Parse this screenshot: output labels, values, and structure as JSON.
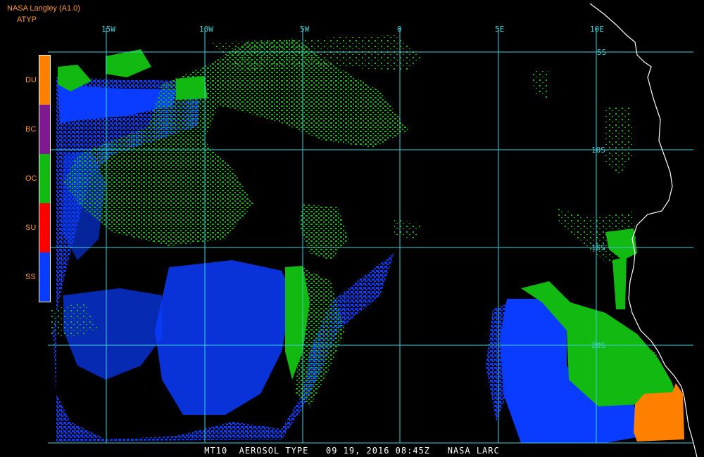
{
  "header": {
    "title": "NASA Langley (A1.0)",
    "product": "ATYP"
  },
  "legend": {
    "items": [
      {
        "code": "DU",
        "color": "#ff8000"
      },
      {
        "code": "BC",
        "color": "#7d1a8f"
      },
      {
        "code": "OC",
        "color": "#11b911"
      },
      {
        "code": "SU",
        "color": "#ff0000"
      },
      {
        "code": "SS",
        "color": "#0a3cff"
      }
    ]
  },
  "map": {
    "longitude_labels": [
      "15W",
      "10W",
      "5W",
      "0",
      "5E",
      "10E"
    ],
    "latitude_labels": [
      "5S",
      "10S",
      "15S",
      "20S"
    ],
    "grid_color": "#40d0d8",
    "coast_color": "#ffffff"
  },
  "caption": "MT10  AEROSOL TYPE   09 19, 2016 08:45Z   NASA LARC"
}
